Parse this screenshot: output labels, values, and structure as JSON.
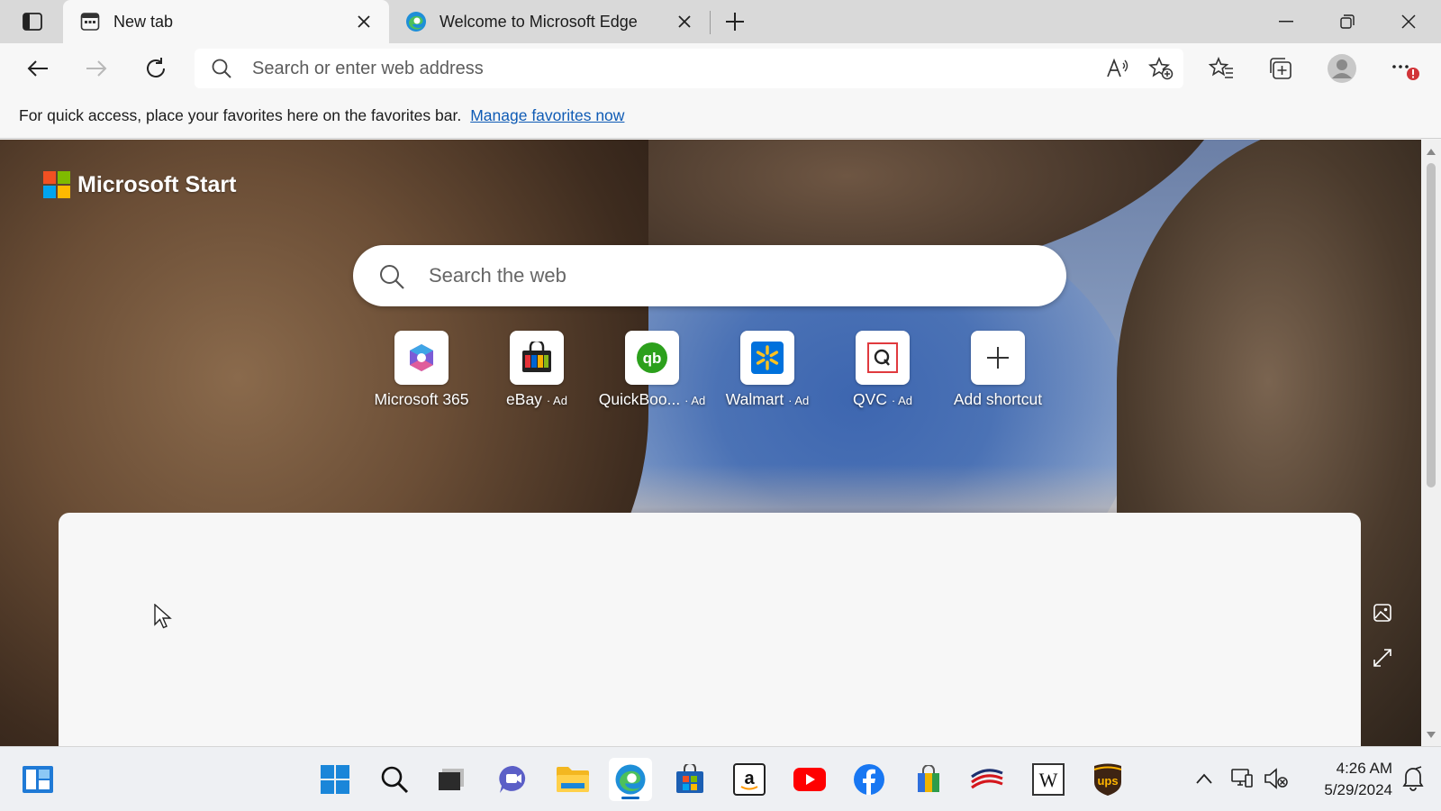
{
  "window": {
    "tabs": [
      {
        "title": "New tab",
        "active": true,
        "icon": "new-tab-page-icon"
      },
      {
        "title": "Welcome to Microsoft Edge",
        "active": false,
        "icon": "edge-logo-icon"
      }
    ]
  },
  "toolbar": {
    "address_placeholder": "Search or enter web address"
  },
  "favorites_bar": {
    "message": "For quick access, place your favorites here on the favorites bar.",
    "link": "Manage favorites now"
  },
  "start": {
    "brand": "Microsoft Start",
    "logo_colors": [
      "#f25022",
      "#7fba00",
      "#00a4ef",
      "#ffb900"
    ],
    "search_placeholder": "Search the web",
    "shortcuts": [
      {
        "label": "Microsoft 365",
        "ad": "",
        "icon": "microsoft-365-icon"
      },
      {
        "label": "eBay",
        "ad": "· Ad",
        "icon": "ebay-bag-icon"
      },
      {
        "label": "QuickBoo...",
        "ad": "· Ad",
        "icon": "quickbooks-icon"
      },
      {
        "label": "Walmart",
        "ad": "· Ad",
        "icon": "walmart-spark-icon"
      },
      {
        "label": "QVC",
        "ad": "· Ad",
        "icon": "qvc-icon"
      },
      {
        "label": "Add shortcut",
        "ad": "",
        "icon": "plus-icon"
      }
    ]
  },
  "taskbar": {
    "time": "4:26 AM",
    "date": "5/29/2024",
    "accent": "#0067c0"
  }
}
